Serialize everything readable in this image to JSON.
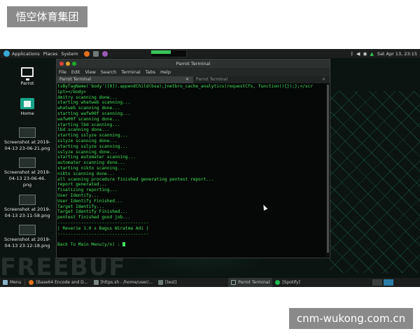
{
  "watermarks": {
    "top": "悟空体育集团",
    "bottom": "cnm-wukong.com.cn"
  },
  "top_panel": {
    "menus": [
      "Applications",
      "Places",
      "System"
    ],
    "clock": "Sat Apr 13, 23:15",
    "tray_icons": [
      "bluetooth-icon",
      "volume-icon",
      "network-icon",
      "lock-icon",
      "power-icon"
    ]
  },
  "desktop": {
    "icons": [
      {
        "label": "Parrot",
        "icon": "computer-icon"
      },
      {
        "label": "Home",
        "icon": "home-folder-icon"
      },
      {
        "label": "Screenshot at 2019-04-13 23-06-21.png",
        "line1": "Screenshot at 2019-",
        "line2": "04-13 23-06-21.png",
        "icon": "image-icon"
      },
      {
        "label": "Screenshot at 2019-04-13 23-06-46.png",
        "line1": "Screenshot at 2019-",
        "line2": "04-13 23-06-46.",
        "line3": "png",
        "icon": "image-icon"
      },
      {
        "label": "Screenshot at 2019-04-13 23-11-58.png",
        "line1": "Screenshot at 2019-",
        "line2": "04-13 23-11-58.png",
        "icon": "image-icon"
      },
      {
        "label": "Screenshot at 2019-04-13 23-12-18.png",
        "line1": "Screenshot at 2019-",
        "line2": "04-13 23-12-18.png",
        "icon": "image-icon"
      }
    ],
    "wallpaper_text": "FREEBUF"
  },
  "terminal": {
    "title": "Parrot Terminal",
    "menu": [
      "File",
      "Edit",
      "View",
      "Search",
      "Terminal",
      "Tabs",
      "Help"
    ],
    "tabs": [
      {
        "label": "Parrot Terminal",
        "active": true
      },
      {
        "label": "Parrot Terminal",
        "active": false
      }
    ],
    "lines": [
      "tsByTagName('body')[0]).appendChild(bsa);}netbro_cache_analytics(requestCfs, function(){});};</scr",
      "ipt></body>",
      "dmitry scanning done...",
      "starting whatweb scanning...",
      "whatweb scanning done...",
      "starting wafw00f scanning...",
      "wafw00f scanning done...",
      "starting lbd scanning...",
      "lbd scanning done...",
      "starting sslyze scanning...",
      "sslyze scanning done...",
      "starting sslyze scanning...",
      "sslyze scanning done...",
      "starting automater scanning...",
      "automater scanning done...",
      "starting nikto scanning...",
      "nikto scanning done...",
      "all scanning procedure finished generating pentest report...",
      "report generated...",
      "finalizing reporting...",
      "User Identify...",
      "User Identify Finished...",
      "Target Identify...",
      "Target Identify Finished...",
      "pentest finished good job...",
      "-----------------------------------",
      "| Reverie 1.0 x Bagus Wiratma Adi |",
      "-----------------------------------",
      ""
    ],
    "prompt": "Back To Main Menu(y/n) : "
  },
  "taskbar": {
    "menu_label": "Menu",
    "items": [
      {
        "label": "[Base64 Encode and D...",
        "icon": "firefox-icon",
        "active": false
      },
      {
        "label": "[https.sh - /home/user/...",
        "icon": "editor-icon",
        "active": false
      },
      {
        "label": "[test]",
        "icon": "folder-icon",
        "active": false
      },
      {
        "label": "Parrot Terminal",
        "icon": "terminal-icon",
        "active": true
      },
      {
        "label": "[Spotify]",
        "icon": "spotify-icon",
        "active": false
      }
    ]
  },
  "colors": {
    "terminal_text": "#43e35b",
    "accent": "#17a589",
    "panel_bg": "#1b1e1d"
  }
}
